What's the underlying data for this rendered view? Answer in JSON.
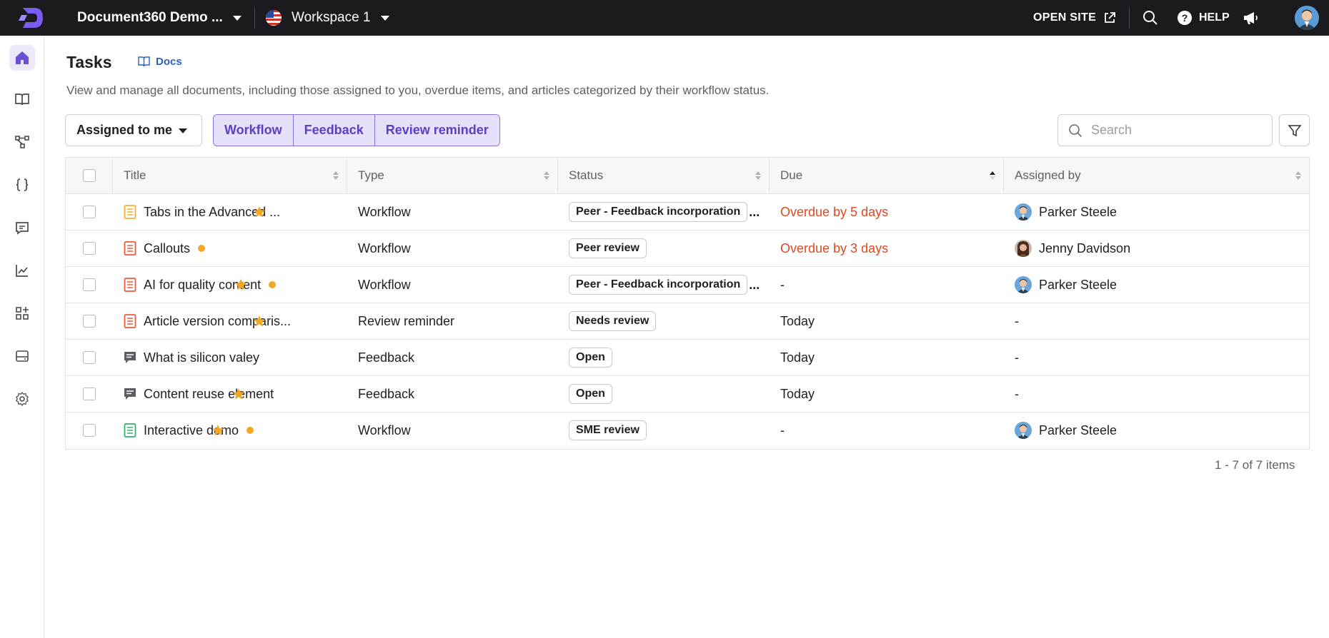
{
  "topbar": {
    "project_name": "Document360 Demo ...",
    "workspace_name": "Workspace 1",
    "open_site_label": "OPEN SITE",
    "help_label": "HELP"
  },
  "page": {
    "title": "Tasks",
    "docs_link": "Docs",
    "description": "View and manage all documents, including those assigned to you, overdue items, and articles categorized by their workflow status."
  },
  "filters": {
    "assigned_label": "Assigned to me",
    "segments": [
      "Workflow",
      "Feedback",
      "Review reminder"
    ],
    "search_placeholder": "Search"
  },
  "table": {
    "columns": [
      "Title",
      "Type",
      "Status",
      "Due",
      "Assigned by"
    ],
    "rows": [
      {
        "title": "Tabs in the Advanced ...",
        "icon": "article-icon-yellow",
        "dot": false,
        "star": true,
        "type": "Workflow",
        "status": "Peer - Feedback incorporation",
        "status_truncated": true,
        "due": "Overdue by 5 days",
        "overdue": true,
        "assigned_by": "Parker Steele",
        "avatar": "parker"
      },
      {
        "title": "Callouts",
        "icon": "article-icon-red",
        "dot": true,
        "star": false,
        "type": "Workflow",
        "status": "Peer review",
        "status_truncated": false,
        "due": "Overdue by 3 days",
        "overdue": true,
        "assigned_by": "Jenny Davidson",
        "avatar": "jenny"
      },
      {
        "title": "AI for quality content",
        "icon": "article-icon-red",
        "dot": true,
        "star": true,
        "type": "Workflow",
        "status": "Peer - Feedback incorporation",
        "status_truncated": true,
        "due": "-",
        "overdue": false,
        "assigned_by": "Parker Steele",
        "avatar": "parker"
      },
      {
        "title": "Article version comparis...",
        "icon": "article-icon-red",
        "dot": false,
        "star": true,
        "type": "Review reminder",
        "status": "Needs review",
        "status_truncated": false,
        "due": "Today",
        "overdue": false,
        "assigned_by": "-",
        "avatar": ""
      },
      {
        "title": "What is silicon valey",
        "icon": "feedback-icon",
        "dot": false,
        "star": false,
        "type": "Feedback",
        "status": "Open",
        "status_truncated": false,
        "due": "Today",
        "overdue": false,
        "assigned_by": "-",
        "avatar": ""
      },
      {
        "title": "Content reuse element",
        "icon": "feedback-icon",
        "dot": false,
        "star": true,
        "type": "Feedback",
        "status": "Open",
        "status_truncated": false,
        "due": "Today",
        "overdue": false,
        "assigned_by": "-",
        "avatar": ""
      },
      {
        "title": "Interactive demo",
        "icon": "article-icon-green",
        "dot": true,
        "star": true,
        "type": "Workflow",
        "status": "SME review",
        "status_truncated": false,
        "due": "-",
        "overdue": false,
        "assigned_by": "Parker Steele",
        "avatar": "parker"
      }
    ]
  },
  "pager": {
    "label": "1 - 7 of 7 items"
  },
  "colors": {
    "accent": "#6a4fd6",
    "overdue": "#e0481f",
    "star": "#f5a623",
    "topbar": "#1b1b1f"
  }
}
